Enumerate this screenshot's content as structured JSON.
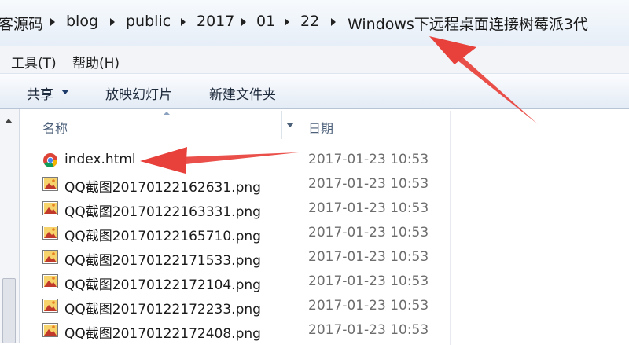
{
  "address": {
    "crumbs": [
      "客源码",
      "blog",
      "public",
      "2017",
      "01",
      "22",
      "Windows下远程桌面连接树莓派3代"
    ]
  },
  "menu": {
    "tools": "工具(T)",
    "help": "帮助(H)"
  },
  "toolbar": {
    "share": "共享",
    "slideshow": "放映幻灯片",
    "new_folder": "新建文件夹"
  },
  "columns": {
    "name": "名称",
    "date": "日期"
  },
  "files": [
    {
      "name": "index.html",
      "date": "2017-01-23 10:53",
      "icon": "chrome-icon"
    },
    {
      "name": "QQ截图20170122162631.png",
      "date": "2017-01-23 10:53",
      "icon": "image-file-icon"
    },
    {
      "name": "QQ截图20170122163331.png",
      "date": "2017-01-23 10:53",
      "icon": "image-file-icon"
    },
    {
      "name": "QQ截图20170122165710.png",
      "date": "2017-01-23 10:53",
      "icon": "image-file-icon"
    },
    {
      "name": "QQ截图20170122171533.png",
      "date": "2017-01-23 10:53",
      "icon": "image-file-icon"
    },
    {
      "name": "QQ截图20170122172104.png",
      "date": "2017-01-23 10:53",
      "icon": "image-file-icon"
    },
    {
      "name": "QQ截图20170122172233.png",
      "date": "2017-01-23 10:53",
      "icon": "image-file-icon"
    },
    {
      "name": "QQ截图20170122172408.png",
      "date": "2017-01-23 10:53",
      "icon": "image-file-icon"
    }
  ],
  "annotation": {
    "arrow_color": "#e8403a"
  }
}
